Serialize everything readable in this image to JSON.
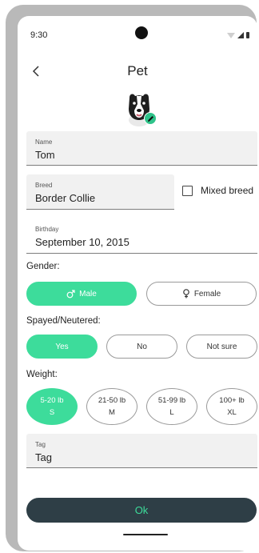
{
  "status": {
    "time": "9:30"
  },
  "header": {
    "title": "Pet",
    "back_icon": "chevron-left-icon"
  },
  "avatar": {
    "icon": "dog-avatar",
    "badge_icon": "pencil-edit-icon",
    "badge_color": "#2fc38a"
  },
  "name_field": {
    "label": "Name",
    "value": "Tom"
  },
  "breed_field": {
    "label": "Breed",
    "value": "Border Collie"
  },
  "mixed_breed": {
    "label": "Mixed breed",
    "checked": false
  },
  "birthday_field": {
    "label": "Birthday",
    "value": "September 10, 2015"
  },
  "gender": {
    "label": "Gender:",
    "options": [
      {
        "label": "Male",
        "icon": "male-symbol-icon",
        "selected": true
      },
      {
        "label": "Female",
        "icon": "female-symbol-icon",
        "selected": false
      }
    ]
  },
  "spayed": {
    "label": "Spayed/Neutered:",
    "options": [
      {
        "label": "Yes",
        "selected": true
      },
      {
        "label": "No",
        "selected": false
      },
      {
        "label": "Not sure",
        "selected": false
      }
    ]
  },
  "weight": {
    "label": "Weight:",
    "options": [
      {
        "range": "5-20 lb",
        "size": "S",
        "selected": true
      },
      {
        "range": "21-50 lb",
        "size": "M",
        "selected": false
      },
      {
        "range": "51-99 lb",
        "size": "L",
        "selected": false
      },
      {
        "range": "100+ lb",
        "size": "XL",
        "selected": false
      }
    ]
  },
  "tag_field": {
    "label": "Tag",
    "value": "Tag"
  },
  "ok_button": {
    "label": "Ok"
  },
  "colors": {
    "accent": "#3ddc9b",
    "button_dark": "#2e3e46",
    "field_bg": "#f1f1f1"
  }
}
